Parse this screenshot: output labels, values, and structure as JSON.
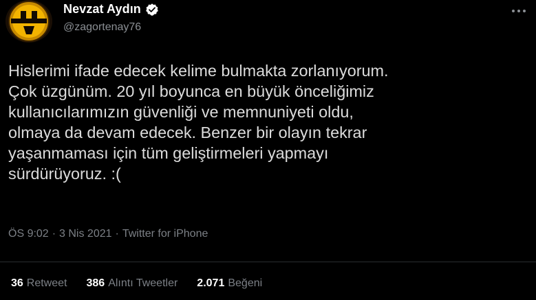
{
  "tweet": {
    "author": {
      "display_name": "Nevzat Aydın",
      "handle": "@zagortenay76",
      "verified": true
    },
    "text": "Hislerimi ifade edecek kelime bulmakta zorlanıyorum.\nÇok üzgünüm. 20 yıl boyunca en büyük önceliğimiz\nkullanıcılarımızın güvenliği ve memnuniyeti oldu,\nolmaya da devam edecek. Benzer bir olayın tekrar\nyaşanmaması için tüm geliştirmeleri yapmayı\nsürdürüyoruz. :(",
    "time": "ÖS 9:02",
    "separator": "·",
    "date": "3 Nis 2021",
    "source": "Twitter for iPhone",
    "more_icon": "more-horizontal-icon"
  },
  "stats": {
    "retweets": {
      "count": "36",
      "label": "Retweet"
    },
    "quotes": {
      "count": "386",
      "label": "Alıntı Tweetler"
    },
    "likes": {
      "count": "2.071",
      "label": "Beğeni"
    }
  },
  "colors": {
    "background": "#000000",
    "name": "#ffffff",
    "secondary": "#7c8086",
    "verified": "#ffffff",
    "avatar_accent": "#e8a400"
  }
}
